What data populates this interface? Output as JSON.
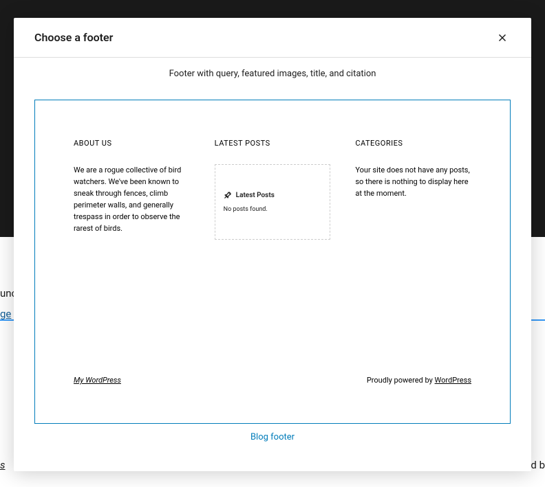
{
  "modal": {
    "title": "Choose a footer"
  },
  "caption_top": "Footer with query, featured images, title, and citation",
  "preview": {
    "about": {
      "heading": "ABOUT US",
      "body": "We are a rogue collective of bird watchers. We've been known to sneak through fences, climb perimeter walls, and generally trespass in order to observe the rarest of birds."
    },
    "latest": {
      "heading": "LATEST POSTS",
      "box_title": "Latest Posts",
      "box_empty": "No posts found."
    },
    "categories": {
      "heading": "CATEGORIES",
      "body": "Your site does not have any posts, so there is nothing to display here at the moment."
    },
    "footer": {
      "site_name": "My WordPress",
      "powered_prefix": "Proudly powered by ",
      "powered_link": "WordPress"
    }
  },
  "caption_bottom": "Blog footer",
  "background": {
    "t1": "unc",
    "t2": "ge",
    "t3": "s",
    "t4": "d b"
  }
}
